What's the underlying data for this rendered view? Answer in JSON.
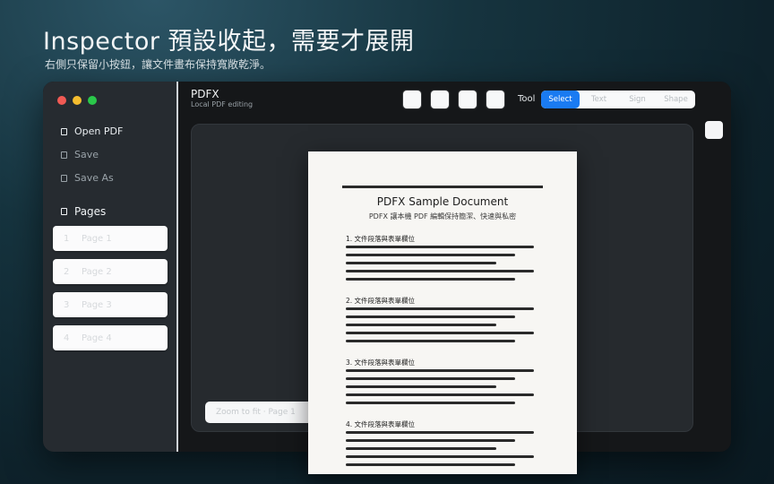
{
  "headline": "Inspector 預設收起，需要才展開",
  "subhead": "右側只保留小按鈕，讓文件畫布保持寬敞乾淨。",
  "sidebar": {
    "items": [
      {
        "label": "Open PDF",
        "icon": "document-icon"
      },
      {
        "label": "Save",
        "icon": "save-icon"
      },
      {
        "label": "Save As",
        "icon": "save-as-icon"
      }
    ],
    "pages_title": "Pages",
    "pages": [
      {
        "num": "1",
        "label": "Page 1"
      },
      {
        "num": "2",
        "label": "Page 2"
      },
      {
        "num": "3",
        "label": "Page 3"
      },
      {
        "num": "4",
        "label": "Page 4"
      }
    ]
  },
  "toolbar": {
    "app_title": "PDFX",
    "app_subtitle": "Local PDF editing",
    "tool_label": "Tool",
    "modes": [
      "Select",
      "Text",
      "Sign",
      "Shape"
    ],
    "active_mode": "Select"
  },
  "document": {
    "title": "PDFX Sample Document",
    "subtitle": "PDFX 讓本機 PDF 編輯保持簡潔、快速與私密",
    "sections": [
      "1. 文件段落與表單欄位",
      "2. 文件段落與表單欄位",
      "3. 文件段落與表單欄位",
      "4. 文件段落與表單欄位"
    ]
  },
  "status_text": "Zoom to fit · Page 1",
  "colors": {
    "accent": "#1a7bf2",
    "sidebar_bg": "#262b30",
    "canvas_bg": "#262a2e"
  }
}
